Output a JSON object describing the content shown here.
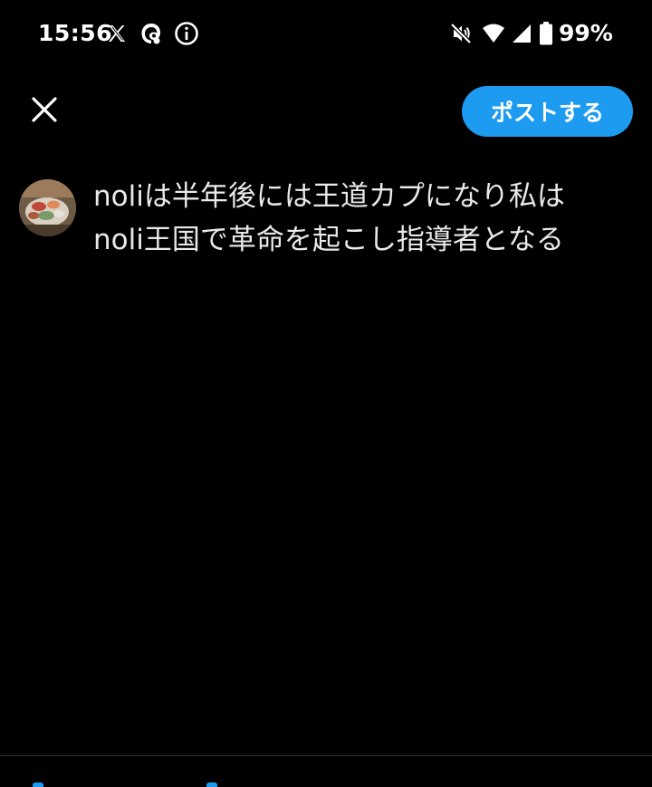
{
  "status_bar": {
    "time": "15:56",
    "battery_percent": "99%",
    "icons": [
      "x-logo-icon",
      "threads-icon",
      "info-icon",
      "mute-icon",
      "wifi-icon",
      "signal-icon",
      "battery-icon"
    ]
  },
  "header": {
    "close_icon": "close-icon",
    "post_button_label": "ポストする"
  },
  "composer": {
    "text": "noliは半年後には王道カプになり私は\nnoli王国で革命を起こし指導者となる"
  },
  "colors": {
    "background": "#000000",
    "accent": "#1d9bf0",
    "text": "#e7e9ea",
    "divider": "#2f3336"
  }
}
